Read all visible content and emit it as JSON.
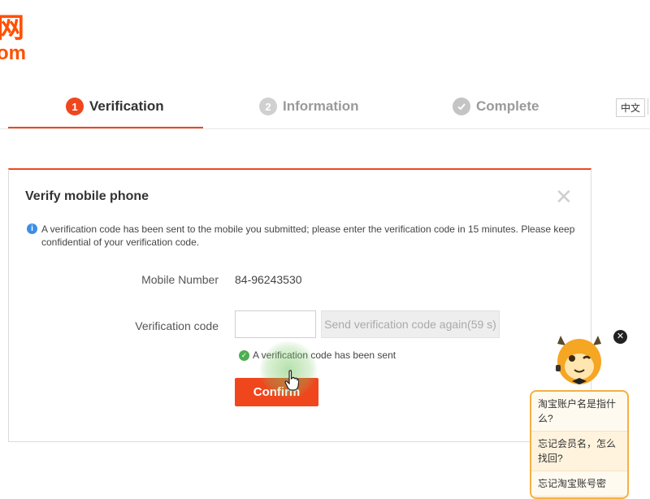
{
  "logo": {
    "line1": "网",
    "line2": "om"
  },
  "steps": [
    {
      "num": "1",
      "label": "Verification",
      "state": "active"
    },
    {
      "num": "2",
      "label": "Information",
      "state": "pending"
    },
    {
      "num": "",
      "label": "Complete",
      "state": "pending"
    }
  ],
  "language": {
    "label": "中文"
  },
  "dialog": {
    "title": "Verify mobile phone",
    "info_icon": "i",
    "info_text": "A verification code has been sent to the mobile you submitted; please enter the verification code in 15 minutes. Please keep confidential of your verification code.",
    "mobile_label": "Mobile Number",
    "mobile_value": "84-96243530",
    "code_label": "Verification code",
    "code_value": "",
    "resend_label": "Send verification code again(59 s)",
    "sent_message": "A verification code has been sent",
    "confirm_label": "Confirm"
  },
  "help": {
    "close_glyph": "✕",
    "items": [
      "淘宝账户名是指什么?",
      "忘记会员名，怎么找回?",
      "忘记淘宝账号密"
    ]
  },
  "colors": {
    "accent": "#f0461e",
    "brand_orange": "#ff5000",
    "success": "#4caf50",
    "info": "#3a8ee6",
    "help_border": "#f5b041"
  },
  "icons": {
    "step_complete": "check-circle-icon",
    "info": "info-icon",
    "success": "check-circle-icon",
    "close": "close-icon",
    "cursor": "hand-cursor-icon",
    "mascot": "mascot-icon"
  }
}
